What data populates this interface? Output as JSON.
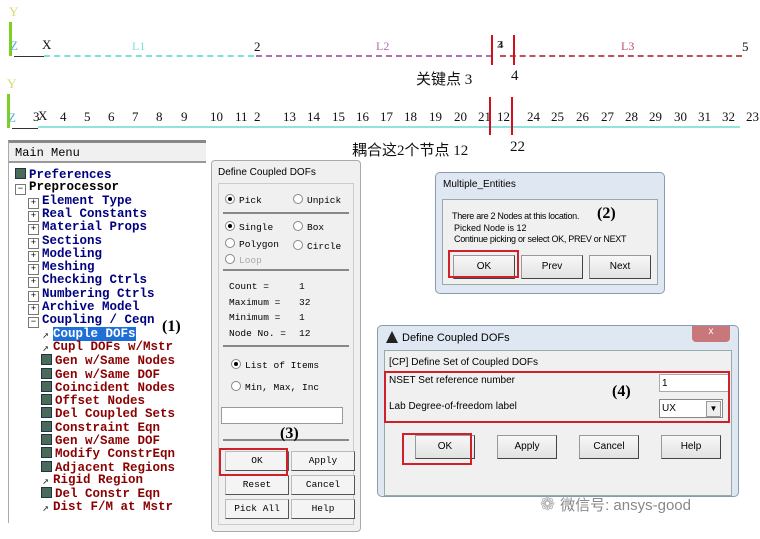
{
  "graphics": {
    "row1": {
      "axis_y": "Y",
      "axis_z": "Z",
      "axis_x": "X",
      "keypoints": [
        "2",
        "3",
        "4",
        "5"
      ],
      "keypoint_overlap": "3",
      "lines": [
        "L1",
        "L2",
        "L3"
      ],
      "line_colors": [
        "#7fe0d8",
        "#b070b0",
        "#c05060"
      ],
      "caption": "关键点 3",
      "caption2": "4"
    },
    "row2": {
      "axis_y": "Y",
      "axis_z": "Z",
      "axis_x": "X",
      "nodes": [
        "3",
        "4",
        "5",
        "6",
        "7",
        "8",
        "9",
        "10",
        "11",
        "2",
        "13",
        "14",
        "15",
        "16",
        "17",
        "18",
        "19",
        "20",
        "21",
        "12",
        "24",
        "25",
        "26",
        "27",
        "28",
        "29",
        "30",
        "31",
        "32",
        "23"
      ],
      "caption": "耦合这2个节点 12",
      "caption2": "22"
    },
    "highlight_color": "#d0101e"
  },
  "main_menu": {
    "title": "Main Menu",
    "items": [
      {
        "label": "Preferences",
        "icon": "calc",
        "color": "#000080",
        "lvl": 0
      },
      {
        "label": "Preprocessor",
        "icon": "minus",
        "color": "#000",
        "lvl": 0
      },
      {
        "label": "Element Type",
        "icon": "plus",
        "color": "#000080",
        "lvl": 1
      },
      {
        "label": "Real Constants",
        "icon": "plus",
        "color": "#000080",
        "lvl": 1
      },
      {
        "label": "Material Props",
        "icon": "plus",
        "color": "#000080",
        "lvl": 1
      },
      {
        "label": "Sections",
        "icon": "plus",
        "color": "#000080",
        "lvl": 1
      },
      {
        "label": "Modeling",
        "icon": "plus",
        "color": "#000080",
        "lvl": 1
      },
      {
        "label": "Meshing",
        "icon": "plus",
        "color": "#000080",
        "lvl": 1
      },
      {
        "label": "Checking Ctrls",
        "icon": "plus",
        "color": "#000080",
        "lvl": 1
      },
      {
        "label": "Numbering Ctrls",
        "icon": "plus",
        "color": "#000080",
        "lvl": 1
      },
      {
        "label": "Archive Model",
        "icon": "plus",
        "color": "#000080",
        "lvl": 1
      },
      {
        "label": "Coupling / Ceqn",
        "icon": "minus",
        "color": "#000080",
        "lvl": 1
      },
      {
        "label": "Couple DOFs",
        "icon": "arrow",
        "color": "#fff",
        "lvl": 2,
        "selected": true
      },
      {
        "label": "Cupl DOFs w/Mstr",
        "icon": "arrow",
        "color": "#8b0000",
        "lvl": 2
      },
      {
        "label": "Gen w/Same Nodes",
        "icon": "calc",
        "color": "#8b0000",
        "lvl": 2
      },
      {
        "label": "Gen w/Same DOF",
        "icon": "calc",
        "color": "#8b0000",
        "lvl": 2
      },
      {
        "label": "Coincident Nodes",
        "icon": "calc",
        "color": "#8b0000",
        "lvl": 2
      },
      {
        "label": "Offset Nodes",
        "icon": "calc",
        "color": "#8b0000",
        "lvl": 2
      },
      {
        "label": "Del Coupled Sets",
        "icon": "calc",
        "color": "#8b0000",
        "lvl": 2
      },
      {
        "label": "Constraint Eqn",
        "icon": "calc",
        "color": "#8b0000",
        "lvl": 2
      },
      {
        "label": "Gen w/Same DOF",
        "icon": "calc",
        "color": "#8b0000",
        "lvl": 2
      },
      {
        "label": "Modify ConstrEqn",
        "icon": "calc",
        "color": "#8b0000",
        "lvl": 2
      },
      {
        "label": "Adjacent Regions",
        "icon": "calc",
        "color": "#8b0000",
        "lvl": 2
      },
      {
        "label": "Rigid Region",
        "icon": "arrow",
        "color": "#8b0000",
        "lvl": 2
      },
      {
        "label": "Del Constr Eqn",
        "icon": "calc",
        "color": "#8b0000",
        "lvl": 2
      },
      {
        "label": "Dist F/M at Mstr",
        "icon": "arrow",
        "color": "#8b0000",
        "lvl": 2
      }
    ],
    "annotation": "(1)"
  },
  "picker": {
    "title": "Define Coupled DOFs",
    "pick": "Pick",
    "unpick": "Unpick",
    "single": "Single",
    "box": "Box",
    "polygon": "Polygon",
    "circle": "Circle",
    "loop": "Loop",
    "count_label": "Count    =",
    "count": "1",
    "max_label": "Maximum  =",
    "max": "32",
    "min_label": "Minimum  =",
    "min": "1",
    "node_label": "Node No. =",
    "node": "12",
    "list_items": "List of Items",
    "min_max_inc": "Min, Max, Inc",
    "input_value": "",
    "ok": "OK",
    "apply": "Apply",
    "reset": "Reset",
    "cancel": "Cancel",
    "pick_all": "Pick All",
    "help": "Help",
    "annotation": "(3)"
  },
  "multiple_entities": {
    "title": "Multiple_Entities",
    "line1": "There are   2 Nodes at this location.",
    "line2": "Picked Node is 12",
    "line3": "Continue picking or select  OK, PREV or NEXT",
    "ok": "OK",
    "prev": "Prev",
    "next": "Next",
    "annotation": "(2)"
  },
  "cp_dialog": {
    "title": "Define Coupled DOFs",
    "close": "x",
    "header": "[CP]  Define Set of Coupled DOFs",
    "nset_label": "NSET  Set reference number",
    "nset_value": "1",
    "lab_label": "Lab   Degree-of-freedom label",
    "lab_value": "UX",
    "ok": "OK",
    "apply": "Apply",
    "cancel": "Cancel",
    "help": "Help",
    "annotation": "(4)"
  },
  "watermark": "微信号: ansys-good"
}
